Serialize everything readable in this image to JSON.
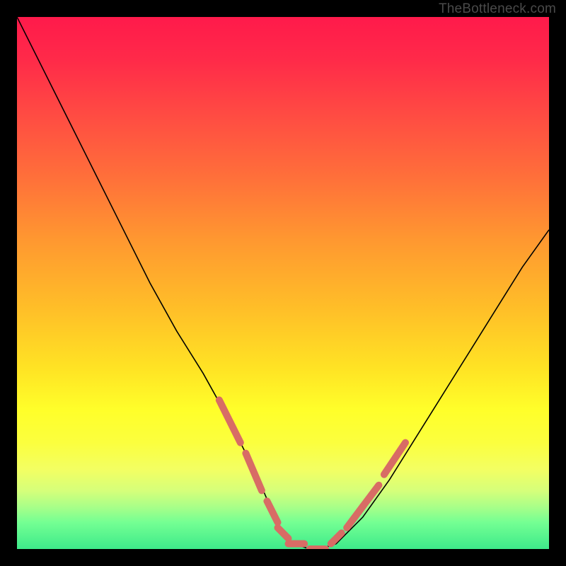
{
  "watermark": "TheBottleneck.com",
  "colors": {
    "gradient_top": "#ff1a4b",
    "gradient_mid": "#ffe324",
    "gradient_bottom": "#3eea8a",
    "curve": "#000000",
    "markers": "#d86c65",
    "background": "#000000"
  },
  "chart_data": {
    "type": "line",
    "title": "",
    "xlabel": "",
    "ylabel": "",
    "xlim": [
      0,
      100
    ],
    "ylim": [
      0,
      100
    ],
    "grid": false,
    "legend": false,
    "x": [
      0,
      5,
      10,
      15,
      20,
      25,
      30,
      35,
      40,
      45,
      48,
      50,
      52,
      55,
      57,
      60,
      65,
      70,
      75,
      80,
      85,
      90,
      95,
      100
    ],
    "y": [
      100,
      90,
      80,
      70,
      60,
      50,
      41,
      33,
      24,
      14,
      7,
      3,
      1,
      0,
      0,
      1,
      6,
      13,
      21,
      29,
      37,
      45,
      53,
      60
    ],
    "note": "Axis values are normalized 0-100 estimates; no tick labels are visible in the source image.",
    "markers": {
      "style": "dashed-rounded",
      "color": "#d86c65",
      "segments_left": [
        {
          "x0": 38,
          "y0": 28,
          "x1": 42,
          "y1": 20
        },
        {
          "x0": 43,
          "y0": 18,
          "x1": 46,
          "y1": 11
        },
        {
          "x0": 47,
          "y0": 9,
          "x1": 49,
          "y1": 5
        },
        {
          "x0": 49,
          "y0": 4,
          "x1": 51,
          "y1": 2
        },
        {
          "x0": 51,
          "y0": 1,
          "x1": 54,
          "y1": 1
        },
        {
          "x0": 55,
          "y0": 0,
          "x1": 58,
          "y1": 0
        }
      ],
      "segments_right": [
        {
          "x0": 59,
          "y0": 1,
          "x1": 61,
          "y1": 3
        },
        {
          "x0": 62,
          "y0": 4,
          "x1": 65,
          "y1": 8
        },
        {
          "x0": 65,
          "y0": 8,
          "x1": 68,
          "y1": 12
        },
        {
          "x0": 69,
          "y0": 14,
          "x1": 73,
          "y1": 20
        }
      ]
    }
  }
}
